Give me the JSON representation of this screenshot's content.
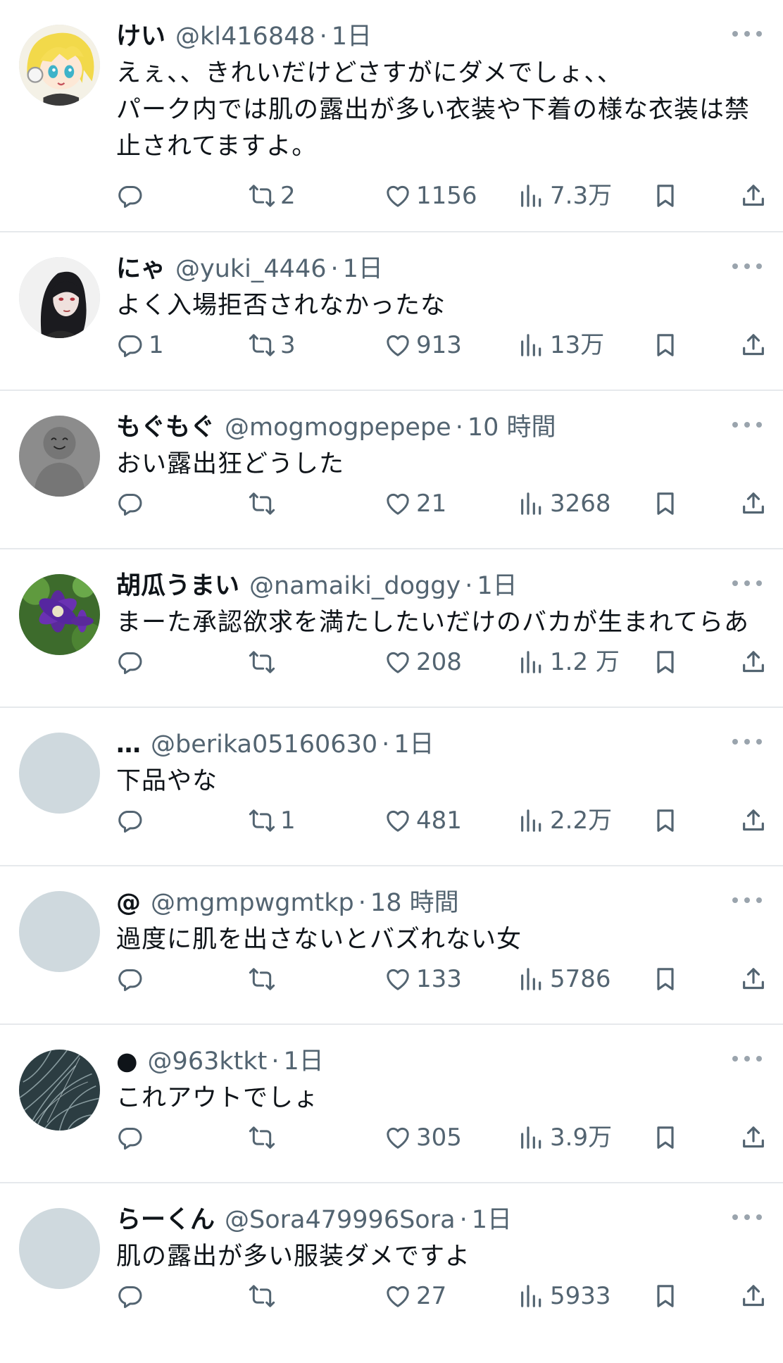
{
  "tweets": [
    {
      "name": "けい",
      "handle": "@kl416848",
      "time": "1日",
      "text": "えぇ、、きれいだけどさすがにダメでしょ、、\nパーク内では肌の露出が多い衣装や下着の様な衣装は禁止されてますよ。",
      "replies": "",
      "retweets": "2",
      "likes": "1156",
      "views": "7.3万",
      "avatar": "anime-blonde-avatar"
    },
    {
      "name": "にゃ",
      "handle": "@yuki_4446",
      "time": "1日",
      "text": "よく入場拒否されなかったな",
      "replies": "1",
      "retweets": "3",
      "likes": "913",
      "views": "13万",
      "avatar": "dark-hair-photo-avatar"
    },
    {
      "name": "もぐもぐ",
      "handle": "@mogmogpepepe",
      "time": "10 時間",
      "text": "おい露出狂どうした",
      "replies": "",
      "retweets": "",
      "likes": "21",
      "views": "3268",
      "avatar": "gray-smiley-avatar"
    },
    {
      "name": "胡瓜うまい",
      "handle": "@namaiki_doggy",
      "time": "1日",
      "text": "まーた承認欲求を満たしたいだけのバカが生まれてらあ",
      "replies": "",
      "retweets": "",
      "likes": "208",
      "views": "1.2 万",
      "avatar": "purple-flower-avatar"
    },
    {
      "name": "…",
      "handle": "@berika05160630",
      "time": "1日",
      "text": "下品やな",
      "replies": "",
      "retweets": "1",
      "likes": "481",
      "views": "2.2万",
      "avatar": "default-avatar"
    },
    {
      "name": "@",
      "handle": "@mgmpwgmtkp",
      "time": "18 時間",
      "text": "過度に肌を出さないとバズれない女",
      "replies": "",
      "retweets": "",
      "likes": "133",
      "views": "5786",
      "avatar": "default-avatar"
    },
    {
      "name": "●",
      "handle": "@963ktkt",
      "time": "1日",
      "text": "これアウトでしょ",
      "replies": "",
      "retweets": "",
      "likes": "305",
      "views": "3.9万",
      "avatar": "dark-grass-avatar"
    },
    {
      "name": "らーくん",
      "handle": "@Sora479996Sora",
      "time": "1日",
      "text": "肌の露出が多い服装ダメですよ",
      "replies": "",
      "retweets": "",
      "likes": "27",
      "views": "5933",
      "avatar": "default-avatar"
    }
  ],
  "colors": {
    "text": "#0f1419",
    "secondary": "#536471",
    "divider": "#e6e9ec",
    "default_avatar": "#cfd9de"
  }
}
